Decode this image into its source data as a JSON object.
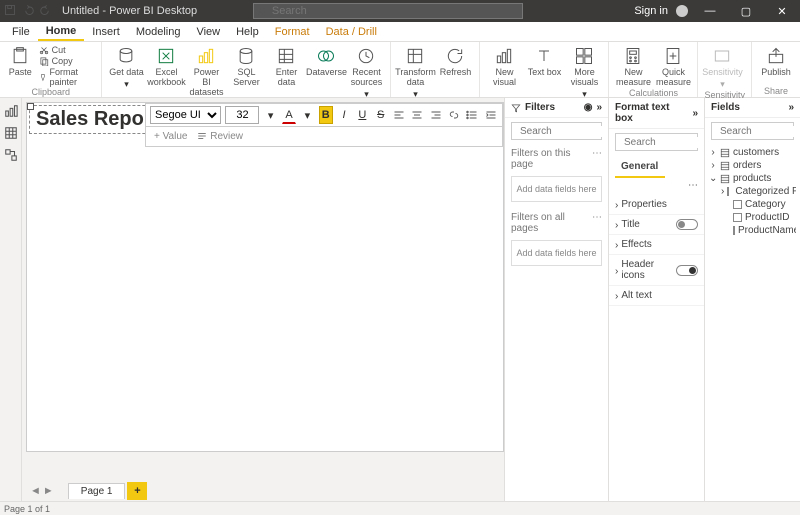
{
  "titlebar": {
    "title": "Untitled - Power BI Desktop",
    "search_placeholder": "Search",
    "signin": "Sign in"
  },
  "tabs": {
    "file": "File",
    "home": "Home",
    "insert": "Insert",
    "modeling": "Modeling",
    "view": "View",
    "help": "Help",
    "format": "Format",
    "datadrill": "Data / Drill"
  },
  "ribbon": {
    "clipboard": {
      "paste": "Paste",
      "cut": "Cut",
      "copy": "Copy",
      "fmtpainter": "Format painter",
      "group": "Clipboard"
    },
    "data": {
      "getdata": "Get data",
      "excel": "Excel workbook",
      "pbi": "Power BI datasets",
      "sql": "SQL Server",
      "enter": "Enter data",
      "dv": "Dataverse",
      "recent": "Recent sources",
      "group": "Data"
    },
    "queries": {
      "transform": "Transform data",
      "refresh": "Refresh",
      "group": "Queries"
    },
    "insert": {
      "newvisual": "New visual",
      "textbox": "Text box",
      "more": "More visuals",
      "group": "Insert"
    },
    "calc": {
      "newmeasure": "New measure",
      "quickmeasure": "Quick measure",
      "group": "Calculations"
    },
    "sens": {
      "sensitivity": "Sensitivity",
      "group": "Sensitivity"
    },
    "share": {
      "publish": "Publish",
      "group": "Share"
    }
  },
  "textbox": {
    "content": "Sales Report"
  },
  "fmtbar": {
    "font": "Segoe UI",
    "size": "32",
    "value": "+ Value",
    "review": "Review"
  },
  "filters": {
    "title": "Filters",
    "search": "Search",
    "onpage": "Filters on this page",
    "allpages": "Filters on all pages",
    "drophint": "Add data fields here"
  },
  "format": {
    "title": "Format text box",
    "search": "Search",
    "general": "General",
    "properties": "Properties",
    "titlerow": "Title",
    "effects": "Effects",
    "headericons": "Header icons",
    "alttext": "Alt text"
  },
  "fields": {
    "title": "Fields",
    "search": "Search",
    "tables": {
      "customers": "customers",
      "orders": "orders",
      "products": "products",
      "pcols": {
        "catprod": "Categorized Pro…",
        "category": "Category",
        "productid": "ProductID",
        "productname": "ProductName"
      }
    }
  },
  "pages": {
    "p1": "Page 1"
  },
  "status": {
    "text": "Page 1 of 1"
  }
}
